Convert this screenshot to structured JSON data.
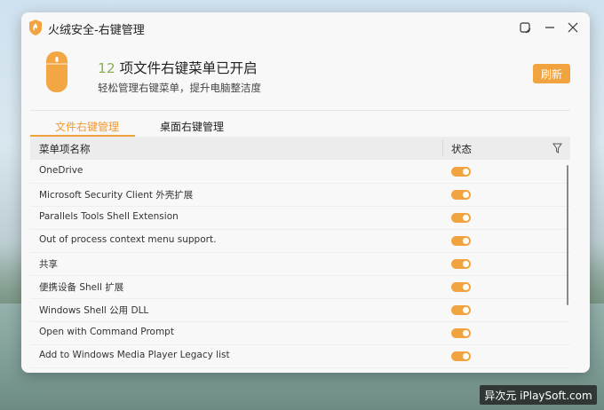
{
  "window": {
    "title": "火绒安全-右键管理"
  },
  "header": {
    "count": "12",
    "headline_rest": " 项文件右键菜单已开启",
    "subtitle": "轻松管理右键菜单，提升电脑整洁度",
    "refresh_label": "刷新"
  },
  "tabs": [
    {
      "label": "文件右键管理",
      "active": true
    },
    {
      "label": "桌面右键管理",
      "active": false
    }
  ],
  "table": {
    "col_name": "菜单项名称",
    "col_status": "状态",
    "rows": [
      {
        "name": "OneDrive",
        "enabled": true
      },
      {
        "name": "Microsoft Security Client 外壳扩展",
        "enabled": true
      },
      {
        "name": "Parallels Tools Shell Extension",
        "enabled": true
      },
      {
        "name": "Out of process context menu support.",
        "enabled": true
      },
      {
        "name": "共享",
        "enabled": true
      },
      {
        "name": "便携设备 Shell 扩展",
        "enabled": true
      },
      {
        "name": "Windows Shell 公用 DLL",
        "enabled": true
      },
      {
        "name": "Open with Command Prompt",
        "enabled": true
      },
      {
        "name": "Add to Windows Media Player Legacy list",
        "enabled": true
      }
    ]
  },
  "colors": {
    "accent": "#f1a33f",
    "count_green": "#8ab14f"
  },
  "watermark": "异次元 iPlaySoft.com"
}
